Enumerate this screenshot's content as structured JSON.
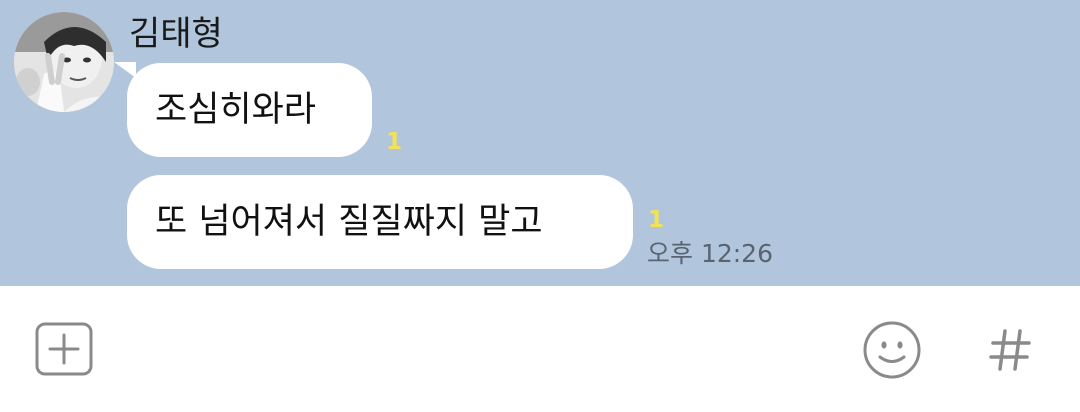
{
  "chat": {
    "sender_name": "김태형",
    "messages": [
      {
        "text": "조심히와라",
        "unread_count": "1"
      },
      {
        "text": "또 넘어져서 질질짜지 말고",
        "unread_count": "1",
        "time": "오후 12:26"
      }
    ]
  },
  "colors": {
    "chat_background": "#b1c6dc",
    "bubble": "#ffffff",
    "unread": "#f3e255",
    "icon": "#8a8a8a"
  },
  "input_bar": {
    "icons": [
      "plus-icon",
      "emoji-icon",
      "hashtag-icon"
    ]
  }
}
